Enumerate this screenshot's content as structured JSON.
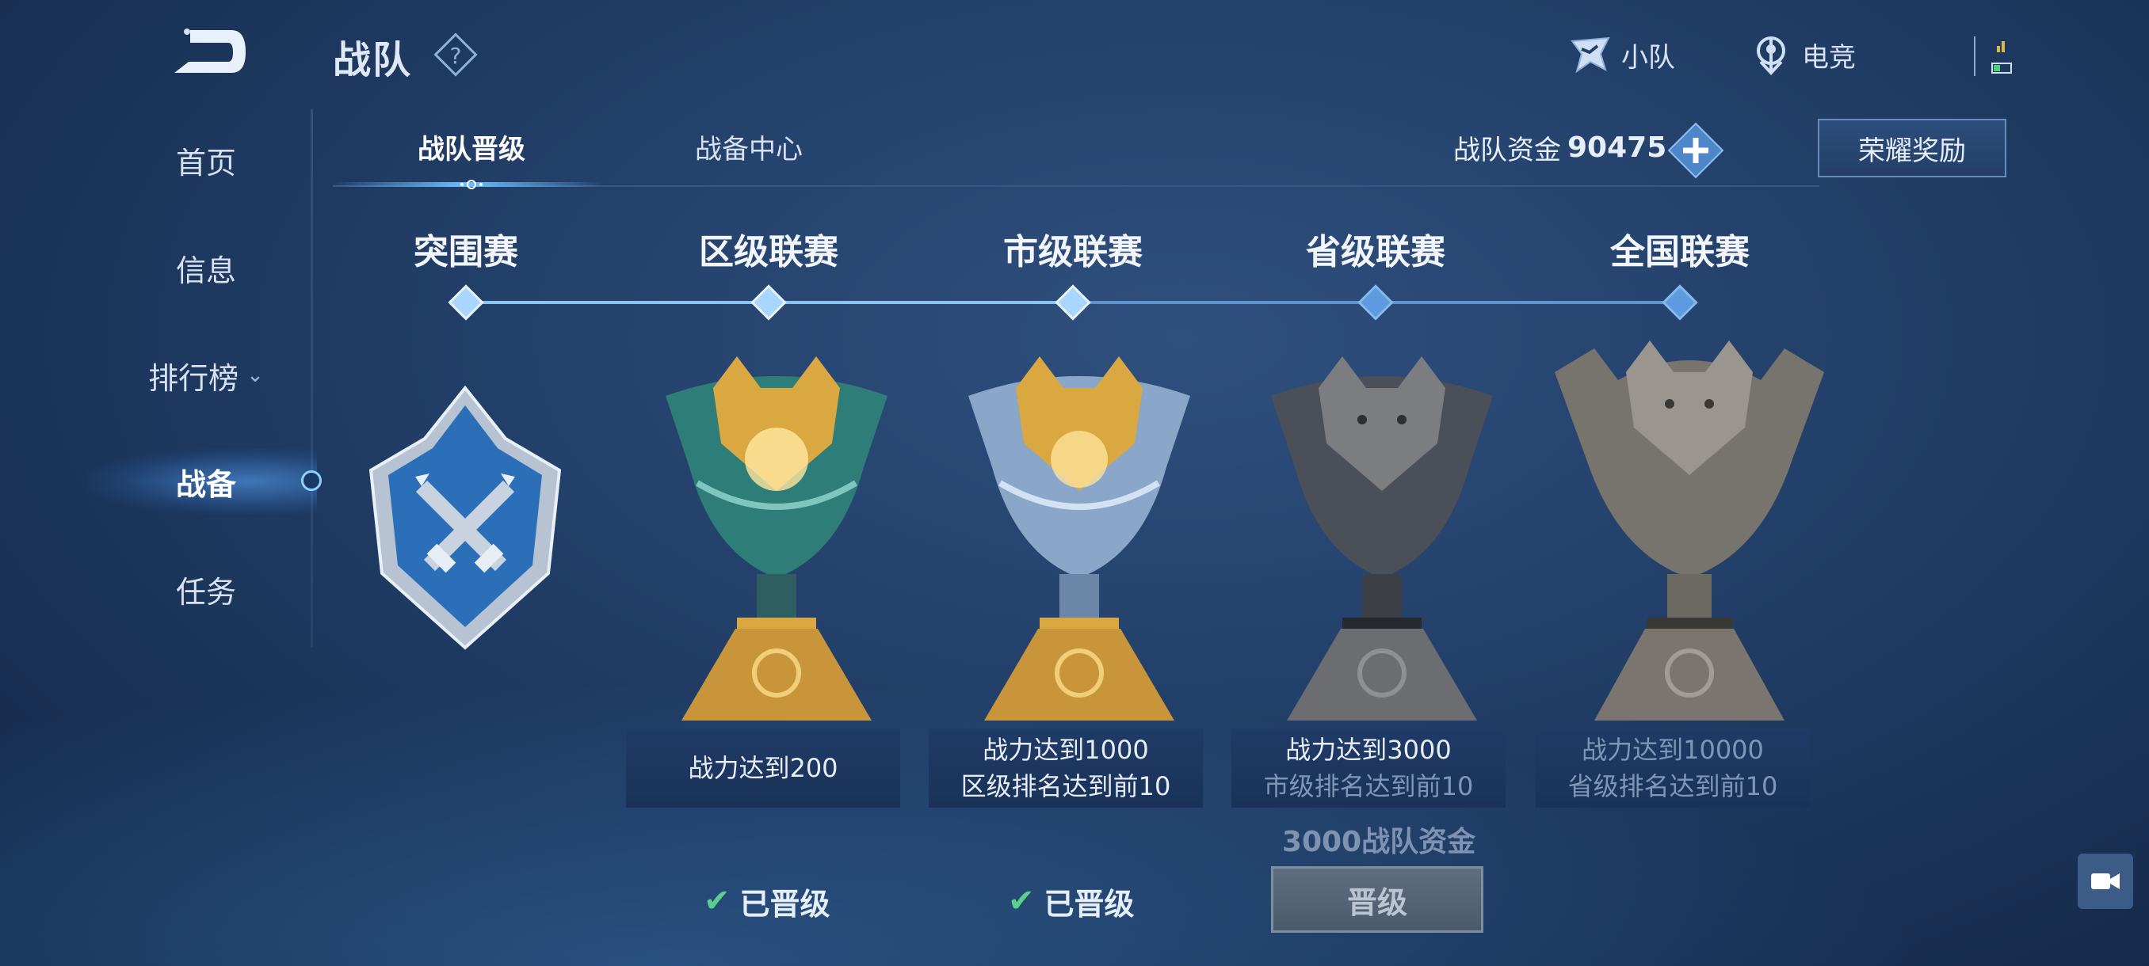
{
  "header": {
    "title": "战队",
    "squad_label": "小队",
    "esports_label": "电竞"
  },
  "sidebar": {
    "items": [
      {
        "label": "首页"
      },
      {
        "label": "信息"
      },
      {
        "label": "排行榜"
      },
      {
        "label": "战备"
      },
      {
        "label": "任务"
      }
    ],
    "active": "战备"
  },
  "tabs": [
    {
      "label": "战队晋级"
    },
    {
      "label": "战备中心"
    }
  ],
  "funds": {
    "label": "战队资金",
    "value": "90475"
  },
  "honor_button": "荣耀奖励",
  "stages": [
    {
      "label": "突围赛"
    },
    {
      "label": "区级联赛"
    },
    {
      "label": "市级联赛"
    },
    {
      "label": "省级联赛"
    },
    {
      "label": "全国联赛"
    }
  ],
  "trophies": [
    {
      "line1": "战力达到200",
      "line2": ""
    },
    {
      "line1": "战力达到1000",
      "line2": "区级排名达到前10"
    },
    {
      "line1": "战力达到3000",
      "line2": "市级排名达到前10"
    },
    {
      "line1": "战力达到10000",
      "line2": "省级排名达到前10"
    }
  ],
  "promoted_label": "已晋级",
  "cost_label": "3000战队资金",
  "promote_button": "晋级",
  "colors": {
    "accent": "#6cc0ff",
    "gold": "#d9a840",
    "jade": "#2f7d78",
    "stone": "#6f7276",
    "check": "#5cd08a"
  }
}
